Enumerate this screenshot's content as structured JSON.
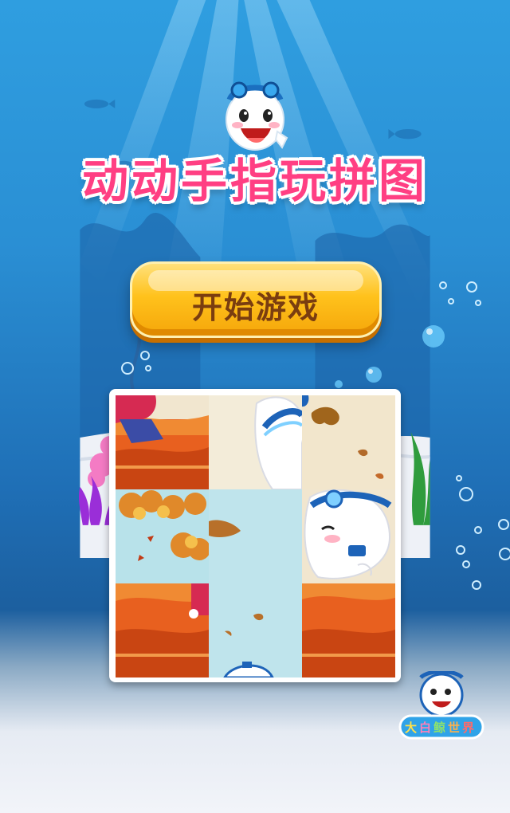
{
  "game": {
    "title": "动动手指玩拼图",
    "start_button_label": "开始游戏",
    "logo_text": "大白鲸世界"
  },
  "puzzle": {
    "rows": 3,
    "cols": 3,
    "tiles": [
      {
        "id": "tile-1",
        "scene": "red-figure-autumn-ground"
      },
      {
        "id": "tile-2",
        "scene": "mascot-goggles-top"
      },
      {
        "id": "tile-3",
        "scene": "falling-leaves-sky"
      },
      {
        "id": "tile-4",
        "scene": "autumn-tree-sky"
      },
      {
        "id": "tile-5",
        "scene": "sky-leaf"
      },
      {
        "id": "tile-6",
        "scene": "mascot-face-whistle"
      },
      {
        "id": "tile-7",
        "scene": "autumn-ground-hand"
      },
      {
        "id": "tile-8",
        "scene": "sky-leaves-goggles"
      },
      {
        "id": "tile-9",
        "scene": "autumn-ground"
      }
    ]
  },
  "colors": {
    "title_pink": "#ff3f83",
    "button_gold": "#ffc21c",
    "ocean_blue": "#2a8fd4",
    "leaf_orange": "#e85a1c"
  }
}
